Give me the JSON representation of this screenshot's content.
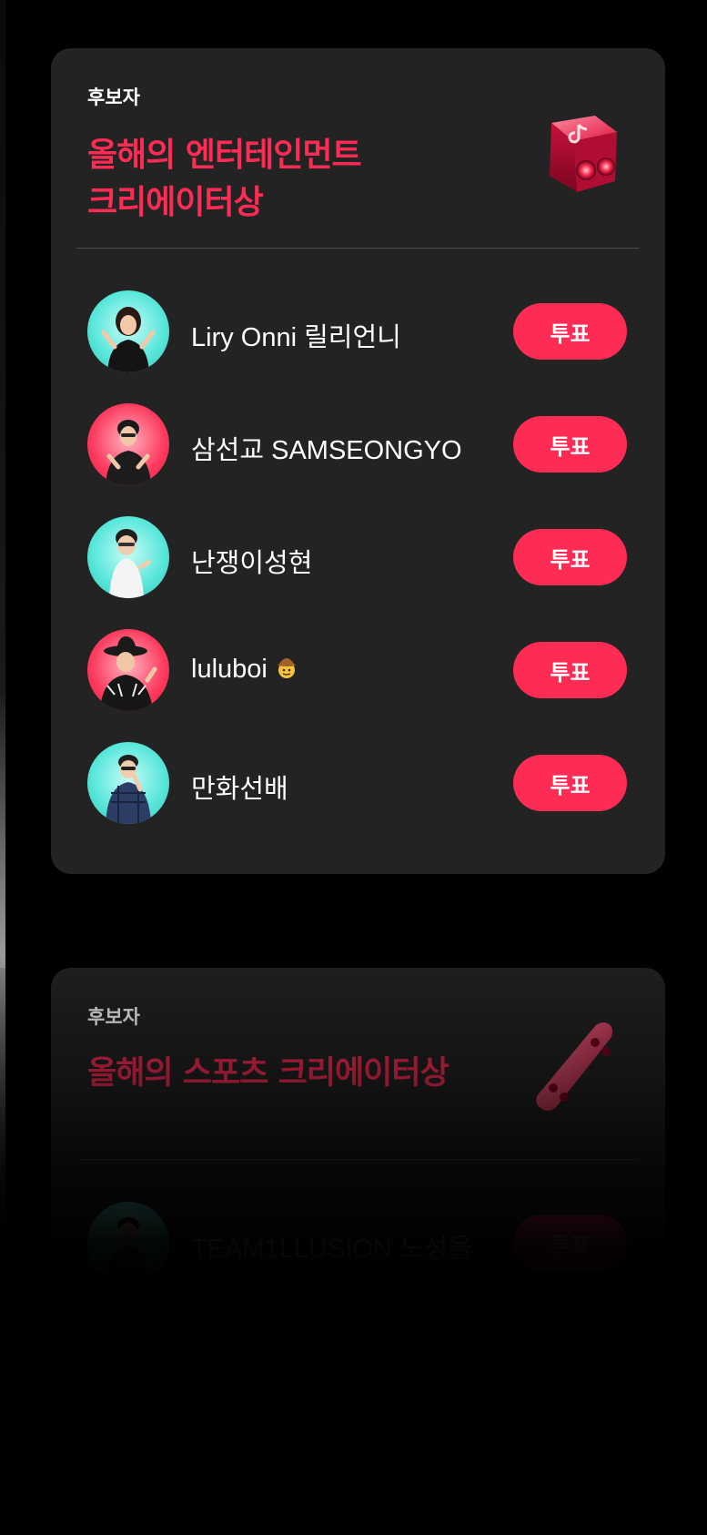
{
  "awards": [
    {
      "eyebrow": "후보자",
      "title_line1": "올해의 엔터테인먼트",
      "title_line2": "크리에이터상",
      "icon": "tiktok-cube-icon",
      "nominees": [
        {
          "name": "Liry Onni 릴리언니",
          "avatar_color": "teal",
          "vote_label": "투표"
        },
        {
          "name": "삼선교 SAMSEONGYO",
          "avatar_color": "red",
          "vote_label": "투표"
        },
        {
          "name": "난쟁이성현",
          "avatar_color": "teal",
          "vote_label": "투표"
        },
        {
          "name": "luluboi",
          "emoji": "cowboy-face-emoji",
          "avatar_color": "red",
          "vote_label": "투표"
        },
        {
          "name": "만화선배",
          "avatar_color": "teal",
          "vote_label": "투표"
        }
      ]
    },
    {
      "eyebrow": "후보자",
      "title_line1": "올해의 스포츠 크리에이터상",
      "icon": "skateboard-icon",
      "nominees": [
        {
          "name": "TEAM1LLUSION 노성율",
          "avatar_color": "teal",
          "vote_label": "투표"
        }
      ]
    }
  ],
  "colors": {
    "accent": "#fe2c55",
    "card_bg": "#232323",
    "page_bg": "#000000",
    "avatar_teal": "#45e0d4",
    "avatar_red": "#fe3a5e"
  }
}
